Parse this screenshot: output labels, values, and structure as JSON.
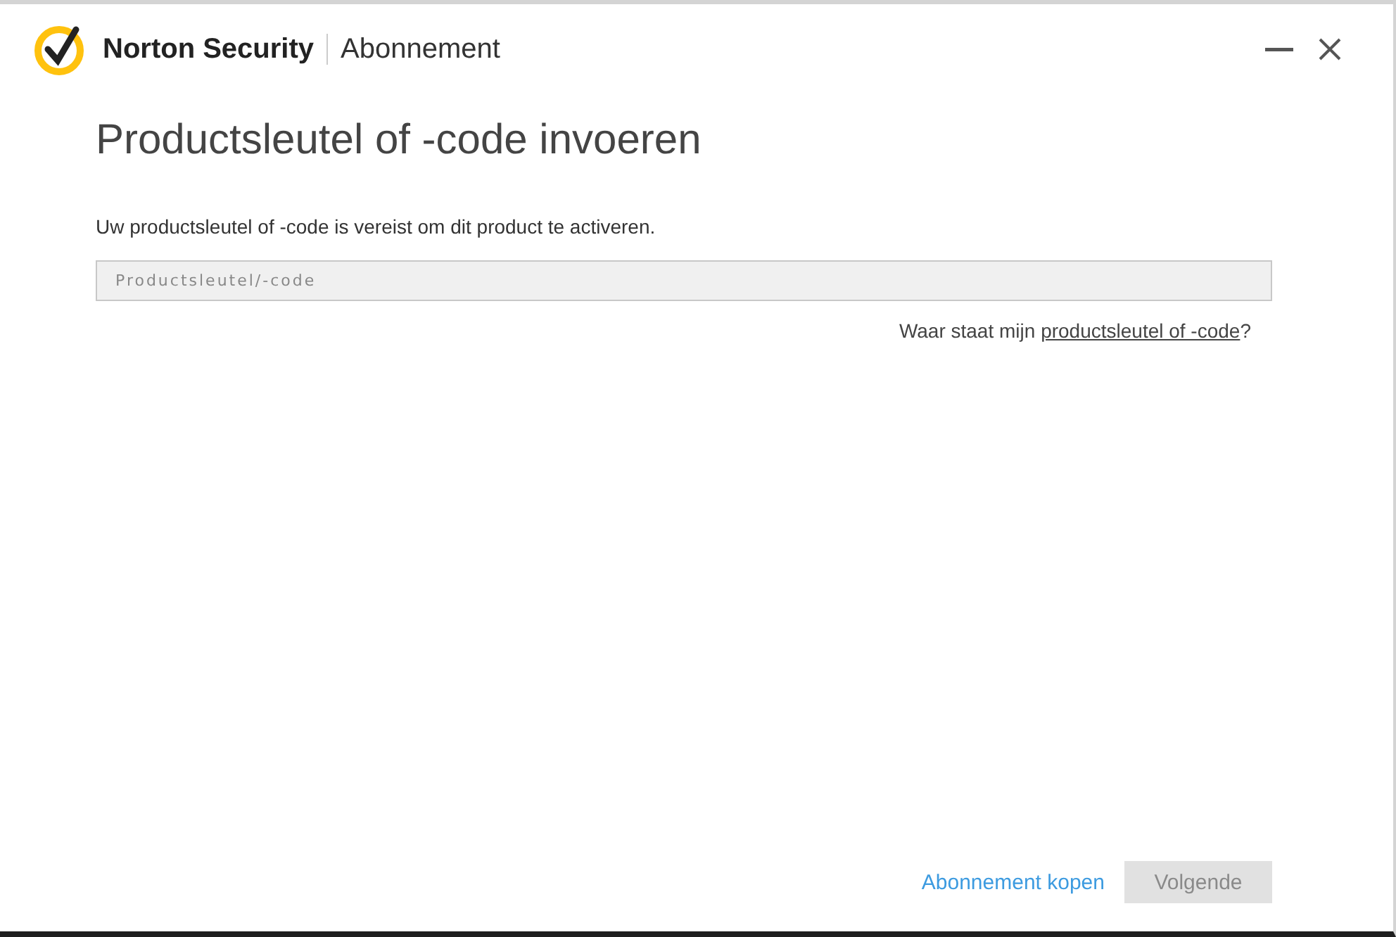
{
  "window": {
    "product": "Norton Security",
    "section": "Abonnement"
  },
  "heading": "Productsleutel of -code invoeren",
  "description": "Uw productsleutel of -code is vereist om dit product te activeren.",
  "key_field": {
    "placeholder": "Productsleutel/-code"
  },
  "help": {
    "text": "Waar staat mijn ",
    "link": "productsleutel of -code",
    "suffix": "?"
  },
  "buy_link": "Abonnement kopen",
  "next_button": {
    "label": "Volgende",
    "disabled": true
  }
}
